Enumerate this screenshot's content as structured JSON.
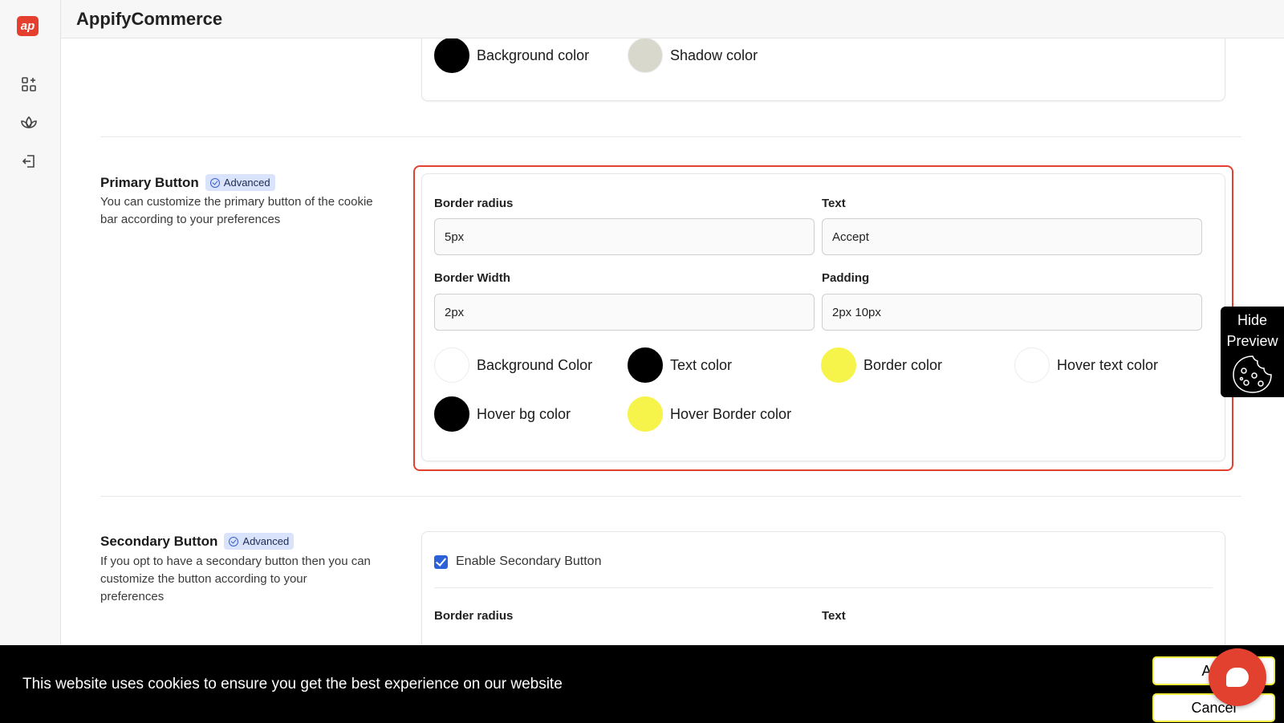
{
  "app": {
    "title": "AppifyCommerce",
    "logo_text": "ap"
  },
  "sidebar": {
    "items": [
      {
        "icon": "apps-add-icon"
      },
      {
        "icon": "lotus-icon"
      },
      {
        "icon": "logout-icon"
      }
    ]
  },
  "top_card": {
    "colors": [
      {
        "label": "Background color",
        "color": "#000000"
      },
      {
        "label": "Shadow color",
        "color": "#d8d9cc"
      }
    ]
  },
  "primary_button": {
    "title": "Primary Button",
    "badge": "Advanced",
    "description": "You can customize the primary button of the cookie bar according to your preferences",
    "fields": {
      "border_radius": {
        "label": "Border radius",
        "value": "5px"
      },
      "text": {
        "label": "Text",
        "value": "Accept"
      },
      "border_width": {
        "label": "Border Width",
        "value": "2px"
      },
      "padding": {
        "label": "Padding",
        "value": "2px 10px"
      }
    },
    "colors": [
      {
        "label": "Background Color",
        "color": "#ffffff"
      },
      {
        "label": "Text color",
        "color": "#000000"
      },
      {
        "label": "Border color",
        "color": "#f6f44a"
      },
      {
        "label": "Hover text color",
        "color": "#ffffff"
      },
      {
        "label": "Hover bg color",
        "color": "#000000"
      },
      {
        "label": "Hover Border color",
        "color": "#f6f44a"
      }
    ]
  },
  "secondary_button": {
    "title": "Secondary Button",
    "badge": "Advanced",
    "description": "If you opt to have a secondary button then you can customize the button according to your preferences",
    "enable_label": "Enable Secondary Button",
    "enabled": true,
    "fields": {
      "border_radius": {
        "label": "Border radius"
      },
      "text": {
        "label": "Text"
      }
    }
  },
  "preview_toggle": {
    "label_line1": "Hide",
    "label_line2": "Preview"
  },
  "cookie_bar": {
    "message": "This website uses cookies to ensure you get the best experience on our website",
    "accept_label": "Acc",
    "cancel_label": "Cancel"
  },
  "colors": {
    "accent": "#e2412f",
    "badge_bg": "#d9e3fb",
    "checkbox": "#2b62d9"
  }
}
